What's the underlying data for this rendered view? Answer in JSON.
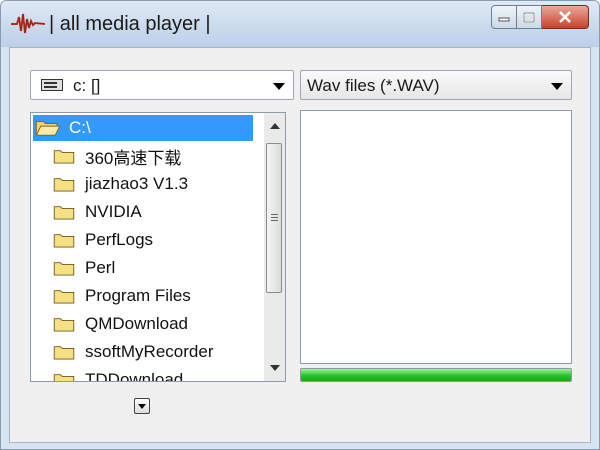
{
  "window": {
    "title": "| all media player |",
    "app_icon": "waveform-icon",
    "controls": [
      "minimize-icon",
      "maximize-icon",
      "close-icon"
    ]
  },
  "drive_selector": {
    "value": "c: []",
    "icon": "drive-icon"
  },
  "file_filter": {
    "value": "Wav files (*.WAV)"
  },
  "directory_list": {
    "items": [
      {
        "label": "C:\\",
        "selected": true,
        "open": true
      },
      {
        "label": "360高速下载",
        "selected": false
      },
      {
        "label": "jiazhao3 V1.3",
        "selected": false
      },
      {
        "label": "NVIDIA",
        "selected": false
      },
      {
        "label": "PerfLogs",
        "selected": false
      },
      {
        "label": "Perl",
        "selected": false
      },
      {
        "label": "Program Files",
        "selected": false
      },
      {
        "label": "QMDownload",
        "selected": false
      },
      {
        "label": "ssoftMyRecorder",
        "selected": false
      },
      {
        "label": "TDDownload",
        "selected": false
      }
    ]
  },
  "file_list": {
    "items": []
  },
  "progress": {
    "value": 1.0
  },
  "colors": {
    "selection": "#3399ff",
    "progress_green": "#25c22a",
    "folder_yellow": "#f7df84"
  }
}
